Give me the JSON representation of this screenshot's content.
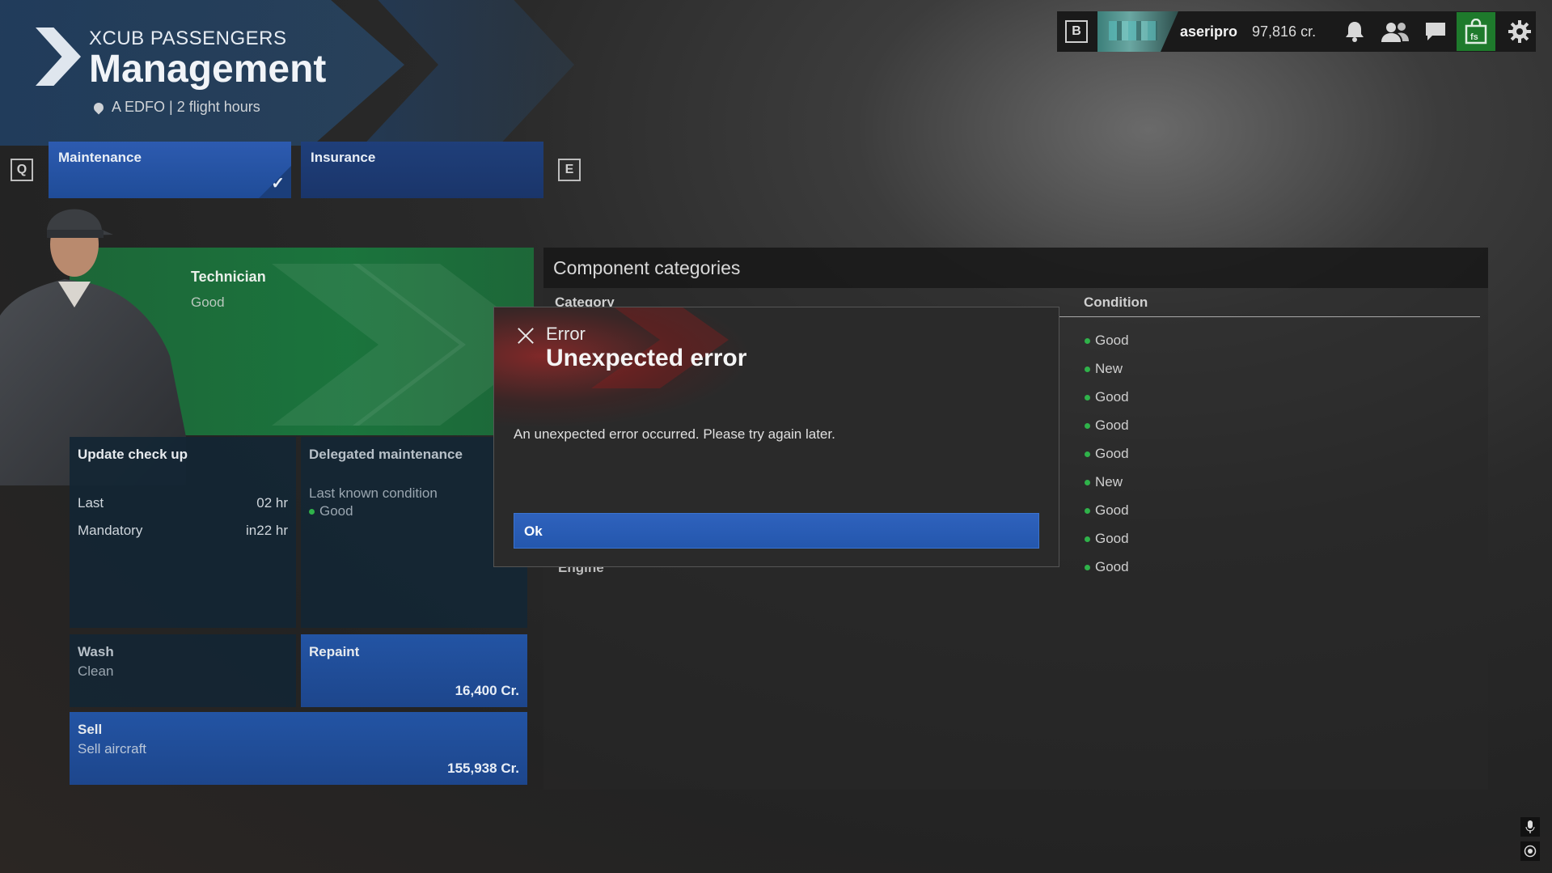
{
  "header": {
    "subtitle": "XCUB PASSENGERS",
    "title": "Management",
    "location": "A EDFO | 2 flight hours"
  },
  "topbar": {
    "key_b": "B",
    "username": "aseripro",
    "credits": "97,816 cr.",
    "icons": [
      "bell-icon",
      "friends-icon",
      "chat-icon",
      "marketplace-icon",
      "gear-icon"
    ]
  },
  "tabs": {
    "key_prev": "Q",
    "key_next": "E",
    "items": [
      {
        "label": "Maintenance",
        "active": true
      },
      {
        "label": "Insurance",
        "active": false
      }
    ]
  },
  "technician": {
    "label": "Technician",
    "value": "Good"
  },
  "cards": {
    "update": {
      "title": "Update check up",
      "last_label": "Last",
      "last_value": "02 hr",
      "mandatory_label": "Mandatory",
      "mandatory_value": "in22 hr"
    },
    "delegated": {
      "title": "Delegated maintenance",
      "subtitle": "Last known condition",
      "condition": "Good"
    },
    "wash": {
      "title": "Wash",
      "value": "Clean"
    },
    "repaint": {
      "title": "Repaint",
      "price": "16,400 Cr."
    },
    "sell": {
      "title": "Sell",
      "subtitle": "Sell aircraft",
      "price": "155,938 Cr."
    }
  },
  "components": {
    "title": "Component categories",
    "col_category": "Category",
    "col_condition": "Condition",
    "visible_category": "Engine",
    "conditions": [
      "Good",
      "New",
      "Good",
      "Good",
      "Good",
      "New",
      "Good",
      "Good",
      "Good"
    ]
  },
  "modal": {
    "label": "Error",
    "title": "Unexpected error",
    "message": "An unexpected error occurred. Please try again later.",
    "ok": "Ok"
  },
  "colors": {
    "accent_blue": "#2457ad",
    "technician_green": "#1a783e",
    "status_green": "#2fb24a",
    "error_red": "#c82828"
  }
}
